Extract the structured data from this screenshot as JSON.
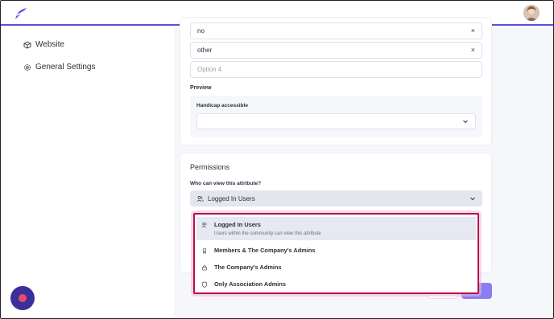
{
  "sidebar": {
    "items": [
      {
        "label": "Website",
        "icon": "cube-icon"
      },
      {
        "label": "General Settings",
        "icon": "gear-icon"
      }
    ]
  },
  "options_fields": [
    {
      "value": "no"
    },
    {
      "value": "other"
    }
  ],
  "new_option_placeholder": "Option 4",
  "preview": {
    "heading": "Preview",
    "field_label": "Handicap accessible"
  },
  "permissions": {
    "heading": "Permissions",
    "question": "Who can view this attribute?",
    "selected": "Logged In Users",
    "options": [
      {
        "label": "Logged In Users",
        "description": "Users within the community can view this attribute",
        "icon": "users-icon"
      },
      {
        "label": "Members & The Company's Admins",
        "icon": "badge-icon"
      },
      {
        "label": "The Company's Admins",
        "icon": "lock-icon"
      },
      {
        "label": "Only Association Admins",
        "icon": "shield-icon"
      }
    ]
  },
  "colors": {
    "accent": "#5b4fe0",
    "highlight_border": "#b5124a",
    "fab": "#3b2f9a"
  }
}
